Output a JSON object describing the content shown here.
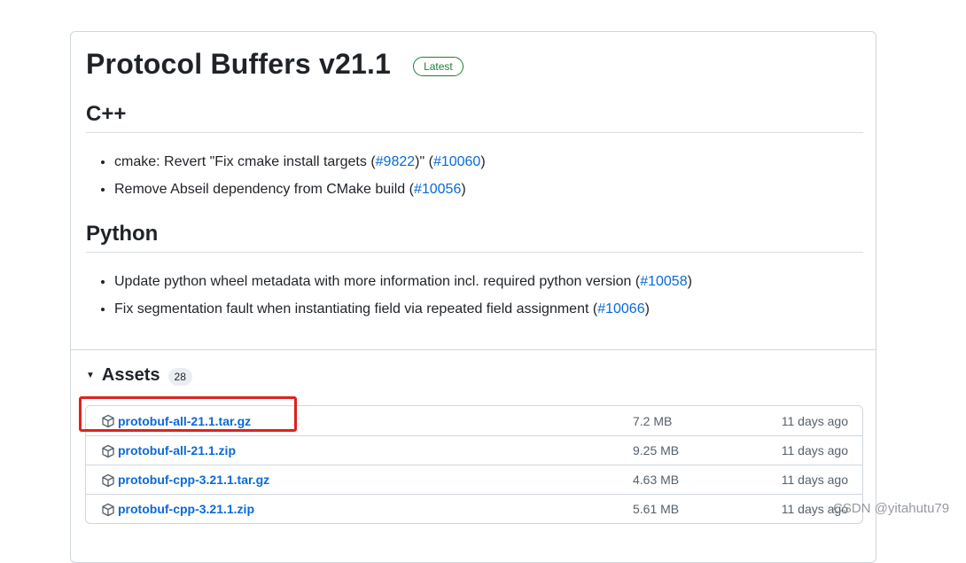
{
  "release": {
    "title": "Protocol Buffers v21.1",
    "badge": "Latest"
  },
  "sections": [
    {
      "heading": "C++",
      "items": [
        {
          "parts": [
            "cmake: Revert \"Fix cmake install targets (",
            "#9822",
            ")\" (",
            "#10060",
            ")"
          ]
        },
        {
          "parts": [
            "Remove Abseil dependency from CMake build (",
            "#10056",
            ")"
          ]
        }
      ]
    },
    {
      "heading": "Python",
      "items": [
        {
          "parts": [
            "Update python wheel metadata with more information incl. required python version (",
            "#10058",
            ")"
          ]
        },
        {
          "parts": [
            "Fix segmentation fault when instantiating field via repeated field assignment (",
            "#10066",
            ")"
          ]
        }
      ]
    }
  ],
  "assets": {
    "title": "Assets",
    "count": "28",
    "caret_icon": "triangle-down-icon",
    "rows": [
      {
        "name": "protobuf-all-21.1.tar.gz",
        "size": "7.2 MB",
        "date": "11 days ago"
      },
      {
        "name": "protobuf-all-21.1.zip",
        "size": "9.25 MB",
        "date": "11 days ago"
      },
      {
        "name": "protobuf-cpp-3.21.1.tar.gz",
        "size": "4.63 MB",
        "date": "11 days ago"
      },
      {
        "name": "protobuf-cpp-3.21.1.zip",
        "size": "5.61 MB",
        "date": "11 days ago"
      }
    ],
    "row_icon": "package-icon"
  },
  "annotation": {
    "color": "#e02020"
  },
  "watermark": "CSDN @yitahutu79",
  "colors": {
    "link": "#0969da",
    "badge_green": "#1a7f37",
    "border": "#d0d7de",
    "muted": "#57606a"
  }
}
